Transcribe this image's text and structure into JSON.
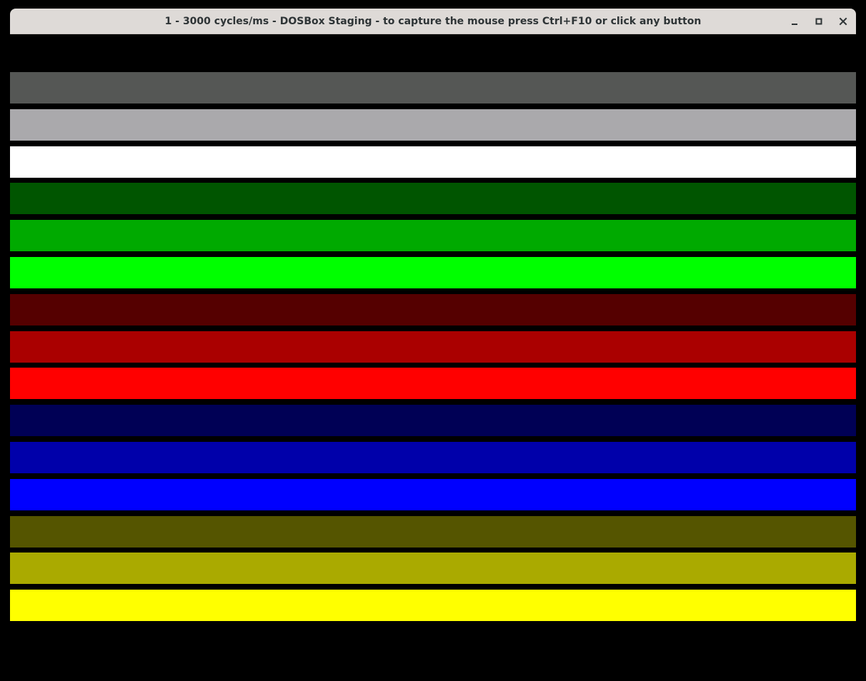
{
  "window": {
    "title": "1 - 3000 cycles/ms - DOSBox Staging - to capture the mouse press Ctrl+F10 or click any button",
    "controls": [
      {
        "name": "minimize-icon"
      },
      {
        "name": "maximize-icon"
      },
      {
        "name": "close-icon"
      }
    ]
  },
  "display": {
    "background": "#000000",
    "bars": [
      {
        "color": "#555755"
      },
      {
        "color": "#aaa9ac"
      },
      {
        "color": "#ffffff"
      },
      {
        "color": "#005500"
      },
      {
        "color": "#00aa00"
      },
      {
        "color": "#00ff00"
      },
      {
        "color": "#550000"
      },
      {
        "color": "#aa0000"
      },
      {
        "color": "#ff0000"
      },
      {
        "color": "#000055"
      },
      {
        "color": "#0000aa"
      },
      {
        "color": "#0000ff"
      },
      {
        "color": "#555500"
      },
      {
        "color": "#aaaa00"
      },
      {
        "color": "#ffff00"
      }
    ]
  }
}
